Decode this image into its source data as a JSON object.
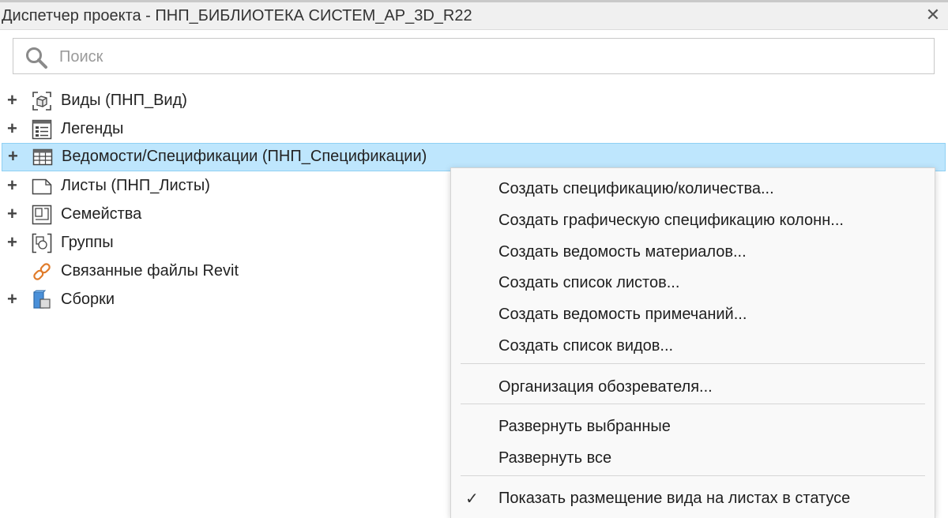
{
  "window": {
    "title": "Диспетчер проекта - ПНП_БИБЛИОТЕКА СИСТЕМ_АР_3D_R22",
    "close_glyph": "✕"
  },
  "search": {
    "placeholder": "Поиск",
    "value": ""
  },
  "tree": {
    "items": [
      {
        "label": "Виды (ПНП_Вид)",
        "expander": "+",
        "icon": "views-icon"
      },
      {
        "label": "Легенды",
        "expander": "+",
        "icon": "legends-icon"
      },
      {
        "label": "Ведомости/Спецификации (ПНП_Спецификации)",
        "expander": "+",
        "icon": "schedules-icon",
        "selected": true
      },
      {
        "label": "Листы (ПНП_Листы)",
        "expander": "+",
        "icon": "sheets-icon"
      },
      {
        "label": "Семейства",
        "expander": "+",
        "icon": "families-icon"
      },
      {
        "label": "Группы",
        "expander": "+",
        "icon": "groups-icon"
      },
      {
        "label": "Связанные файлы Revit",
        "expander": "",
        "icon": "revit-links-icon"
      },
      {
        "label": "Сборки",
        "expander": "+",
        "icon": "assemblies-icon"
      }
    ]
  },
  "context_menu": {
    "items": [
      {
        "label": "Создать спецификацию/количества..."
      },
      {
        "label": "Создать графическую спецификацию колонн..."
      },
      {
        "label": "Создать ведомость материалов..."
      },
      {
        "label": "Создать список листов..."
      },
      {
        "label": "Создать ведомость примечаний..."
      },
      {
        "label": "Создать список видов..."
      },
      {
        "label": "Организация обозревателя..."
      },
      {
        "label": "Развернуть выбранные"
      },
      {
        "label": "Развернуть все"
      },
      {
        "label": "Показать размещение вида на листах в статусе",
        "checked": true,
        "check_glyph": "✓"
      }
    ]
  },
  "colors": {
    "selection_bg": "#bee6fd",
    "selection_border": "#8fd0f3",
    "link_icon": "#e07b2a",
    "assembly_icon": "#4a90d9"
  }
}
